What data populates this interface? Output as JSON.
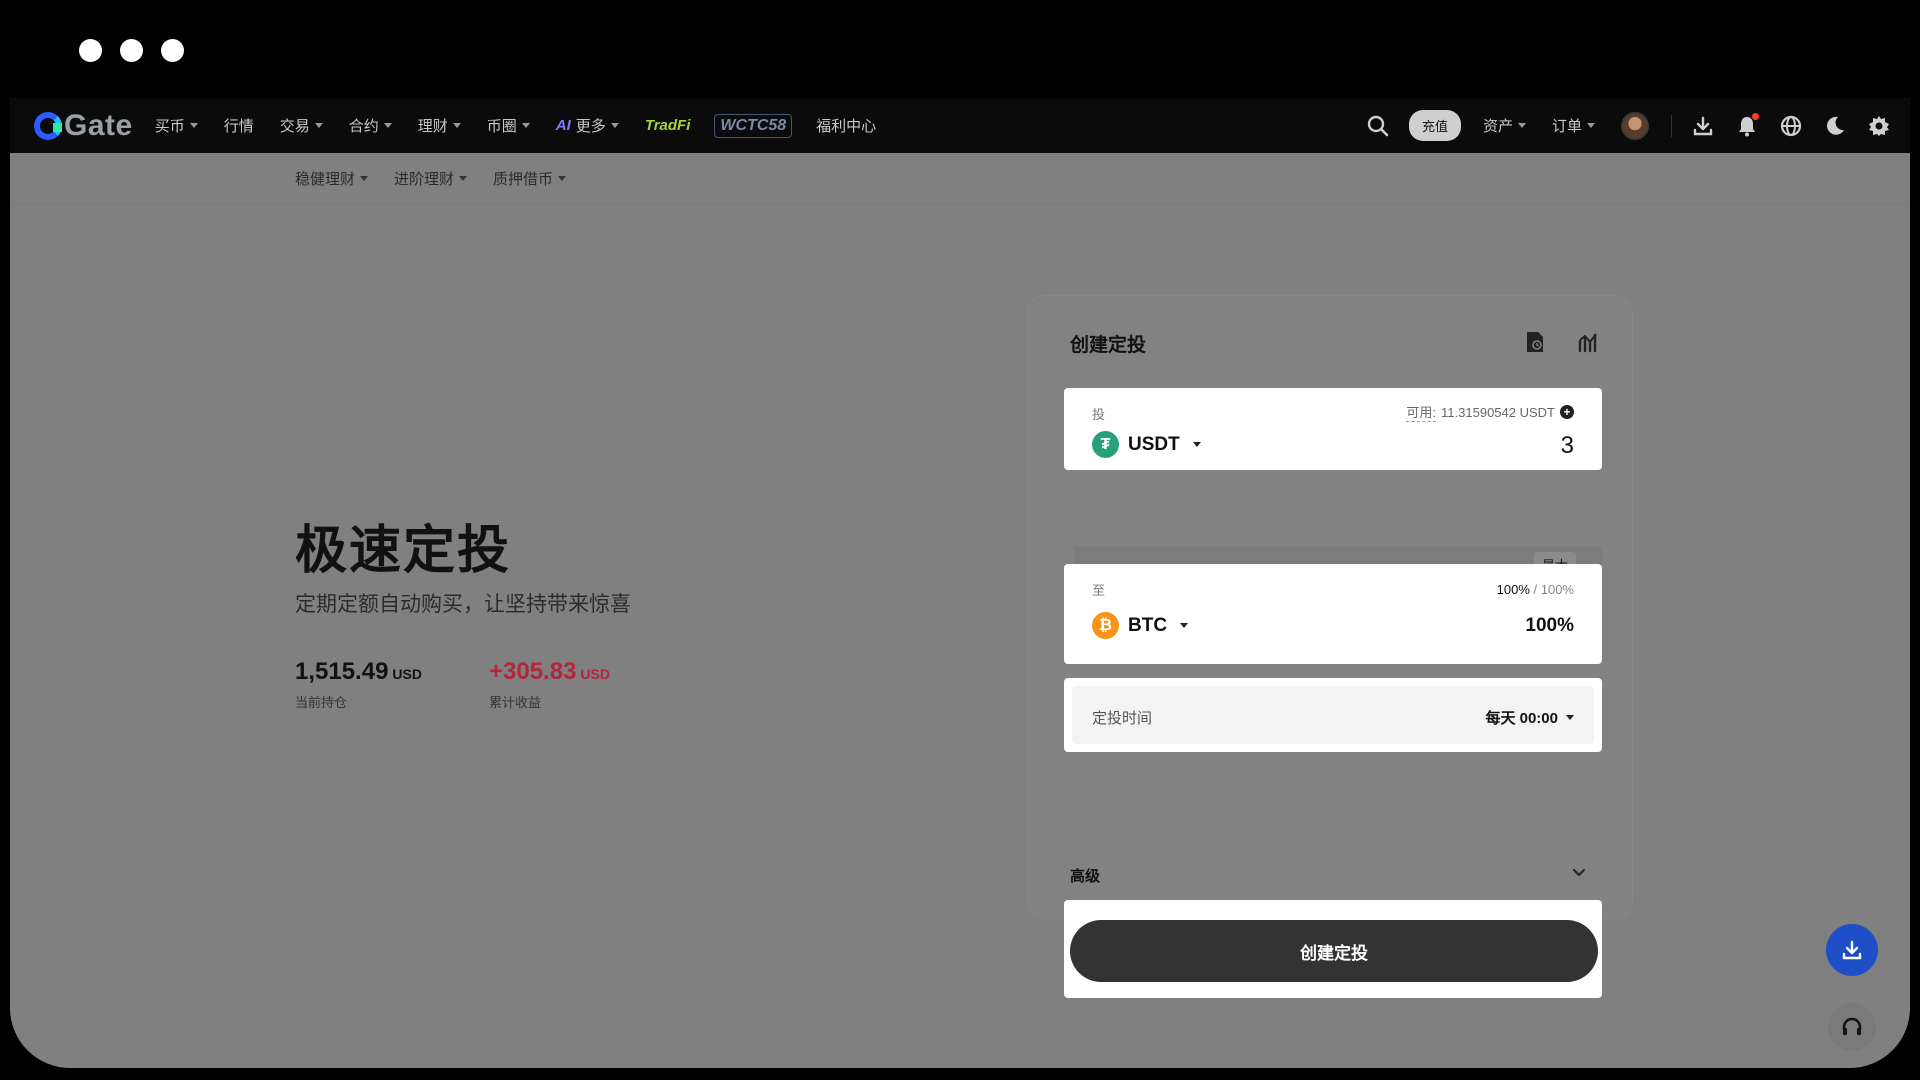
{
  "nav": {
    "logo": "Gate",
    "items": [
      {
        "label": "买币",
        "dropdown": true
      },
      {
        "label": "行情",
        "dropdown": false
      },
      {
        "label": "交易",
        "dropdown": true
      },
      {
        "label": "合约",
        "dropdown": true
      },
      {
        "label": "理财",
        "dropdown": true
      },
      {
        "label": "币圈",
        "dropdown": true
      }
    ],
    "ai_badge": "AI",
    "more_label": "更多",
    "tradfi_label": "TradFi",
    "wctc_label": "WCTC58",
    "welfare_label": "福利中心",
    "deposit_label": "充值",
    "assets_label": "资产",
    "orders_label": "订单"
  },
  "subnav": {
    "items": [
      "稳健理财",
      "进阶理财",
      "质押借币"
    ]
  },
  "hero": {
    "title": "极速定投",
    "subtitle": "定期定额自动购买，让坚持带来惊喜",
    "holdings_value": "1,515.49",
    "holdings_unit": "USD",
    "holdings_label": "当前持仓",
    "profit_value": "+305.83",
    "profit_unit": "USD",
    "profit_label": "累计收益"
  },
  "panel": {
    "title": "创建定投",
    "invest_label": "投",
    "available_prefix": "可用:",
    "available_value": "11.31590542 USDT",
    "from_coin": "USDT",
    "amount": "3",
    "max_label": "最大",
    "to_label": "至",
    "alloc_used": "100%",
    "alloc_total": "/ 100%",
    "to_coin": "BTC",
    "to_pct": "100%",
    "time_label": "定投时间",
    "time_value": "每天 00:00",
    "advanced_label": "高级",
    "create_label": "创建定投"
  },
  "colors": {
    "usdt": "#26a17b",
    "btc": "#f7931a",
    "profit": "#b3263a",
    "download_fab": "#1f4fc7"
  }
}
